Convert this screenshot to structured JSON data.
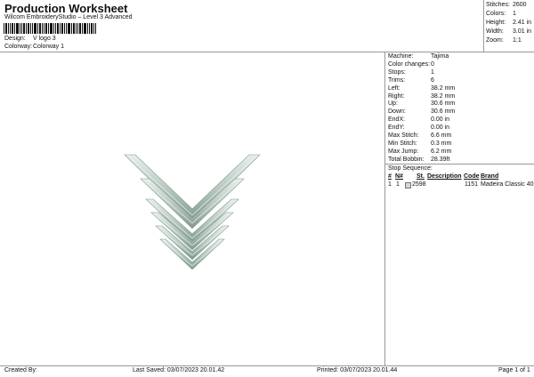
{
  "header": {
    "title": "Production Worksheet",
    "subtitle": "Wilcom EmbroideryStudio – Level 3 Advanced",
    "design_label": "Design:",
    "design_value": "V logo 3",
    "colorway_label": "Colorway:",
    "colorway_value": "Colorway 1"
  },
  "summary": {
    "stitches_label": "Stitches:",
    "stitches": "2600",
    "colors_label": "Colors:",
    "colors": "1",
    "height_label": "Height:",
    "height": "2.41 in",
    "width_label": "Width:",
    "width": "3.01 in",
    "zoom_label": "Zoom:",
    "zoom": "1:1"
  },
  "details": [
    {
      "label": "Machine:",
      "value": "Tajima"
    },
    {
      "label": "Color changes:",
      "value": "0"
    },
    {
      "label": "Stops:",
      "value": "1"
    },
    {
      "label": "Trims:",
      "value": "6"
    },
    {
      "label": "Left:",
      "value": "38.2 mm"
    },
    {
      "label": "Right:",
      "value": "38.2 mm"
    },
    {
      "label": "Up:",
      "value": "30.6 mm"
    },
    {
      "label": "Down:",
      "value": "30.6 mm"
    },
    {
      "label": "EndX:",
      "value": "0.00 in"
    },
    {
      "label": "EndY:",
      "value": "0.00 in"
    },
    {
      "label": "Max Stitch:",
      "value": "6.6 mm"
    },
    {
      "label": "Min Stitch:",
      "value": "0.3 mm"
    },
    {
      "label": "Max Jump:",
      "value": "6.2 mm"
    },
    {
      "label": "Total Bobbin:",
      "value": "28.39ft"
    }
  ],
  "stop_sequence": {
    "title": "Stop Sequence:",
    "headers": {
      "num": "#",
      "n": "N#",
      "st": "St.",
      "desc": "Description",
      "code": "Code",
      "brand": "Brand"
    },
    "rows": [
      {
        "num": "1",
        "n": "1",
        "st": "2598",
        "desc": "",
        "code": "1151",
        "brand": "Madeira Classic 40"
      }
    ]
  },
  "footer": {
    "created_by": "Created By:",
    "last_saved": "Last Saved: 03/07/2023 20.01.42",
    "printed": "Printed: 03/07/2023 20.01.44",
    "page": "Page 1 of 1"
  },
  "colors": {
    "thread": "#cfd9d4",
    "thread_dark": "#7f9a8c",
    "thread_light": "#eef3f0"
  },
  "design_icon": "v-chevron-logo"
}
